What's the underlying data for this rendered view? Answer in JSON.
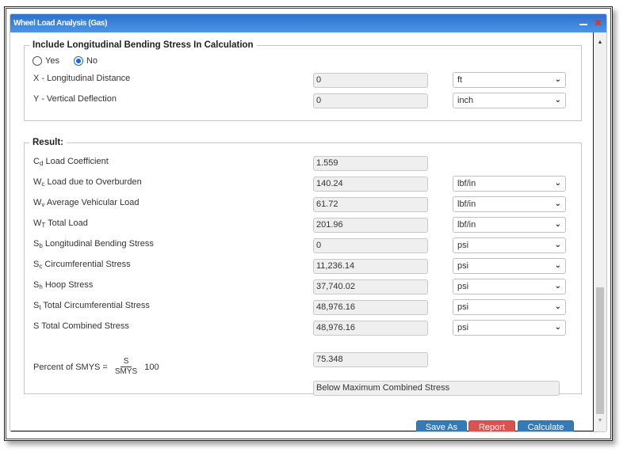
{
  "window": {
    "title": "Wheel Load Analysis (Gas)",
    "minimize_icon": "minimize-icon",
    "close_icon": "close-icon"
  },
  "bending_section": {
    "legend": "Include Longitudinal Bending Stress In Calculation",
    "radio": {
      "options": [
        {
          "label": "Yes",
          "checked": false
        },
        {
          "label": "No",
          "checked": true
        }
      ]
    },
    "rows": [
      {
        "label": "X - Longitudinal Distance",
        "value": "0",
        "unit": "ft"
      },
      {
        "label": "Y - Vertical Deflection",
        "value": "0",
        "unit": "inch"
      }
    ]
  },
  "result_section": {
    "legend": "Result:",
    "rows": [
      {
        "sym": "C",
        "sub": "d",
        "label": " Load Coefficient",
        "value": "1.559",
        "unit": null
      },
      {
        "sym": "W",
        "sub": "c",
        "label": " Load due to Overburden",
        "value": "140.24",
        "unit": "lbf/in"
      },
      {
        "sym": "W",
        "sub": "v",
        "label": " Average Vehicular Load",
        "value": "61.72",
        "unit": "lbf/in"
      },
      {
        "sym": "W",
        "sub": "T",
        "label": " Total Load",
        "value": "201.96",
        "unit": "lbf/in"
      },
      {
        "sym": "S",
        "sub": "b",
        "label": " Longitudinal Bending Stress",
        "value": "0",
        "unit": "psi"
      },
      {
        "sym": "S",
        "sub": "c",
        "label": " Circumferential Stress",
        "value": "11,236.14",
        "unit": "psi"
      },
      {
        "sym": "S",
        "sub": "h",
        "label": " Hoop Stress",
        "value": "37,740.02",
        "unit": "psi"
      },
      {
        "sym": "S",
        "sub": "t",
        "label": " Total Circumferential Stress",
        "value": "48,976.16",
        "unit": "psi"
      },
      {
        "sym": "S",
        "sub": "",
        "label": " Total Combined Stress",
        "value": "48,976.16",
        "unit": "psi"
      }
    ],
    "smys": {
      "prefix": "Percent of SMYS =",
      "numerator": "S",
      "denominator": "SMYS",
      "multiplier": "100",
      "value": "75.348"
    },
    "status": "Below Maximum Combined Stress"
  },
  "buttons": {
    "save_as": "Save As",
    "report": "Report",
    "calculate": "Calculate"
  },
  "scrollbar": {
    "up_icon": "▲",
    "down_icon": "▼"
  },
  "colors": {
    "title_bar": "#3e86dc",
    "primary_button": "#337ab7",
    "danger_button": "#d9534f",
    "close_icon": "#e53030"
  }
}
